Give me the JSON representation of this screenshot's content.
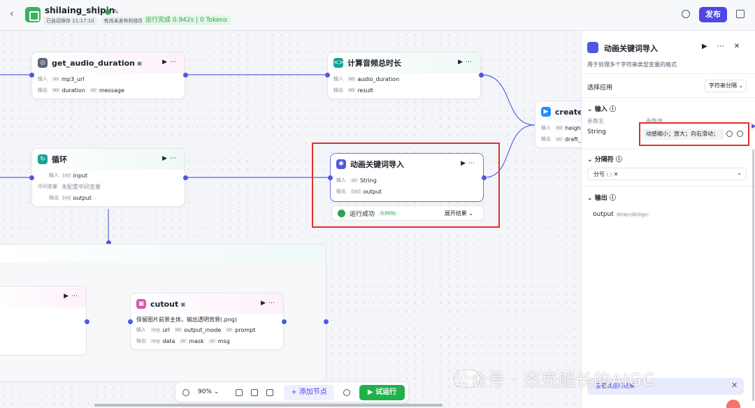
{
  "header": {
    "back_icon": "chevron-left-icon",
    "app_name": "shilaing_shipin",
    "autosave": "已自动保存 11:17:10",
    "unpublished": "有尚未发布的修改",
    "run_status": "运行完成 0.942s | 0 Tokens",
    "publish_label": "发布"
  },
  "nodes": {
    "audio_duration": {
      "name": "get_audio_duration",
      "in_label": "输入",
      "out_label": "输出",
      "in1_type": "str",
      "in1": "mp3_url",
      "out1_type": "N0",
      "out1": "duration",
      "out2_type": "str",
      "out2": "message"
    },
    "calc_duration": {
      "name": "计算音频总时长",
      "in_label": "输入",
      "out_label": "输出",
      "in1_type": "N0",
      "in1": "audio_duration",
      "out1_type": "N0",
      "out1": "result"
    },
    "create_draft": {
      "name": "create_d",
      "in_label": "输入",
      "out_label": "输出",
      "in1_type": "N0",
      "in1": "height",
      "out1_type": "str",
      "out1": "draft_c"
    },
    "loop": {
      "name": "循环",
      "in_label": "输入",
      "mid_label": "中间变量",
      "mid_value": "未配置中间变量",
      "out_label": "输出",
      "in1_type": "[m]",
      "in1": "input",
      "out1_type": "[m]",
      "out1": "output"
    },
    "anim_keyword": {
      "name": "动画关键词导入",
      "in_label": "输入",
      "out_label": "输出",
      "in1_type": "str",
      "in1": "String",
      "out1_type": "[str]",
      "out1": "output",
      "status": "运行成功",
      "time": "0.000s",
      "expand": "展开结果"
    },
    "cutout": {
      "name": "cutout",
      "desc": "保留图片前景主体，输出透明背景(.png)",
      "in_label": "输入",
      "out_label": "输出",
      "in1_type": "img",
      "in1": "url",
      "in2_type": "N0",
      "in2": "output_mode",
      "in3_type": "str",
      "in3": "prompt",
      "out1_type": "img",
      "out1": "data",
      "out2_type": "str",
      "out2": "mask",
      "out3_type": "str",
      "out3": "msg"
    }
  },
  "toolbar": {
    "zoom": "90%",
    "add_node": "添加节点",
    "run": "试运行"
  },
  "panel": {
    "title": "动画关键词导入",
    "desc": "用于处理多个字符串类型变量的格式",
    "select_app_label": "选择应用",
    "select_app_value": "字符串分隔",
    "input_section": "输入",
    "param_name_label": "参数名",
    "param_value_label": "参数值",
    "param_name": "String",
    "param_value": "动感缩小；放大；向右滑动；",
    "delimiter_section": "分隔符",
    "delimiter_value": "分号",
    "delimiter_symbol": "(;)",
    "output_section": "输出",
    "output_name": "output",
    "output_type": "Array<String>",
    "toast_link": "查看试运行结果"
  },
  "watermark": "公众号 · 杰克船长的AIGC"
}
